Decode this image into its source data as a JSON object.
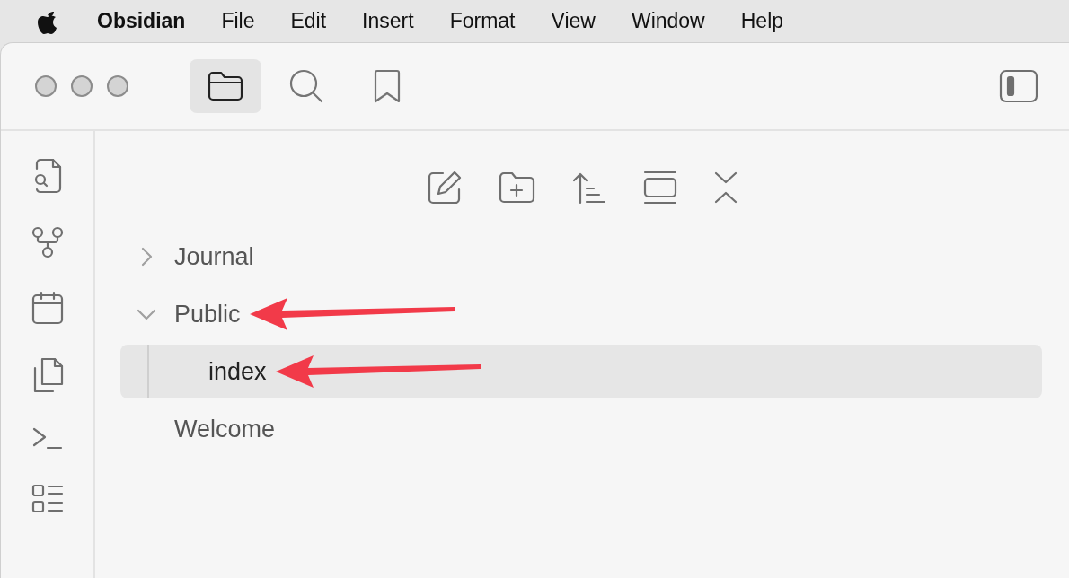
{
  "menu_bar": {
    "app": "Obsidian",
    "items": [
      "File",
      "Edit",
      "Insert",
      "Format",
      "View",
      "Window",
      "Help"
    ]
  },
  "sidebar_tabs": [
    {
      "kind": "files",
      "selected": true
    },
    {
      "kind": "search",
      "selected": false
    },
    {
      "kind": "bookmarks",
      "selected": false
    }
  ],
  "file_tree": [
    {
      "name": "Journal",
      "kind": "folder",
      "expanded": false,
      "selected": false,
      "arrow": false
    },
    {
      "name": "Public",
      "kind": "folder",
      "expanded": true,
      "selected": false,
      "arrow": true,
      "children": [
        {
          "name": "index",
          "kind": "file",
          "selected": true,
          "arrow": true
        }
      ]
    },
    {
      "name": "Welcome",
      "kind": "file",
      "selected": false,
      "arrow": false
    }
  ]
}
